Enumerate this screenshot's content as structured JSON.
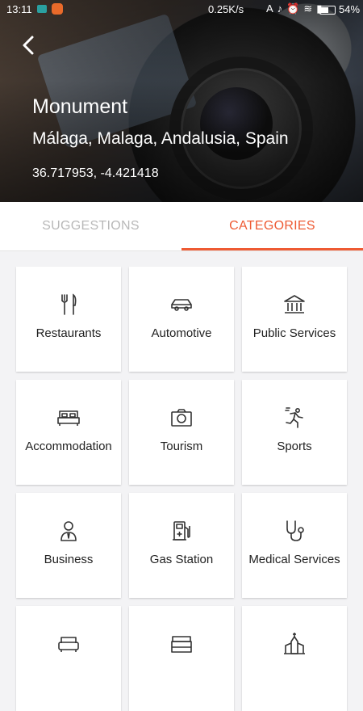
{
  "status_bar": {
    "time": "13:11",
    "network_speed": "0.25K/s",
    "battery_percent": "54%",
    "battery_level": 0.54
  },
  "header": {
    "back_icon": "arrow-left-icon",
    "title": "Monument",
    "address": "Málaga, Malaga, Andalusia, Spain",
    "coordinates": "36.717953, -4.421418"
  },
  "tabs": [
    {
      "label": "SUGGESTIONS",
      "active": false
    },
    {
      "label": "CATEGORIES",
      "active": true
    }
  ],
  "accent_color": "#ee5a33",
  "categories": [
    {
      "label": "Restaurants",
      "icon": "fork-knife-icon"
    },
    {
      "label": "Automotive",
      "icon": "car-icon"
    },
    {
      "label": "Public Services",
      "icon": "building-columns-icon"
    },
    {
      "label": "Accommodation",
      "icon": "bed-icon"
    },
    {
      "label": "Tourism",
      "icon": "camera-icon"
    },
    {
      "label": "Sports",
      "icon": "runner-icon"
    },
    {
      "label": "Business",
      "icon": "businessman-icon"
    },
    {
      "label": "Gas Station",
      "icon": "gas-pump-icon"
    },
    {
      "label": "Medical Services",
      "icon": "stethoscope-icon"
    },
    {
      "label": "",
      "icon": "sofa-icon"
    },
    {
      "label": "",
      "icon": "cash-register-icon"
    },
    {
      "label": "",
      "icon": "church-icon"
    }
  ]
}
